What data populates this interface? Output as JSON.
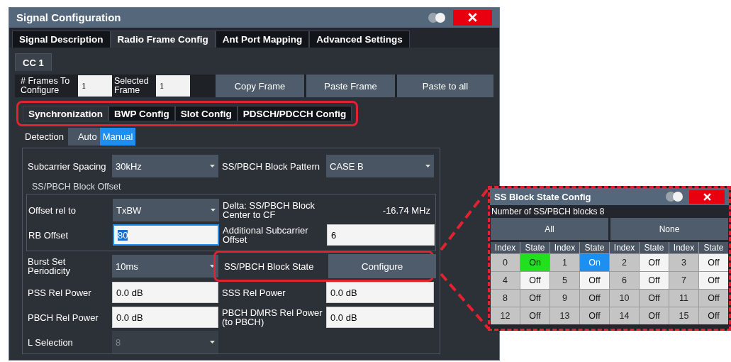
{
  "dialog": {
    "title": "Signal Configuration"
  },
  "tabs": [
    {
      "label": "Signal Description",
      "selected": false
    },
    {
      "label": "Radio Frame Config",
      "selected": true
    },
    {
      "label": "Ant Port Mapping",
      "selected": false
    },
    {
      "label": "Advanced Settings",
      "selected": false
    }
  ],
  "carrier_tabs": [
    {
      "label": "CC 1",
      "selected": true
    }
  ],
  "frames": {
    "frames_label": "# Frames To Configure",
    "frames_value": "1",
    "selected_label": "Selected Frame",
    "selected_value": "1"
  },
  "frame_buttons": [
    "Copy Frame",
    "Paste Frame",
    "Paste to all"
  ],
  "sub_tabs": {
    "highlighted": true,
    "items": [
      {
        "label": "Synchronization",
        "selected": true
      },
      {
        "label": "BWP Config",
        "selected": false
      },
      {
        "label": "Slot Config",
        "selected": false
      },
      {
        "label": "PDSCH/PDCCH Config",
        "selected": false
      }
    ]
  },
  "detection": {
    "label": "Detection",
    "options": [
      {
        "label": "Auto",
        "selected": false
      },
      {
        "label": "Manual",
        "selected": true
      }
    ]
  },
  "rows_top": [
    {
      "cells": [
        {
          "label": "Subcarrier Spacing",
          "kind": "dropdown",
          "value": "30kHz"
        },
        {
          "label": "SS/PBCH Block Pattern",
          "kind": "dropdown",
          "value": "CASE B"
        }
      ]
    }
  ],
  "offset_group": {
    "label": "SS/PBCH Block Offset",
    "rows": [
      {
        "cells": [
          {
            "label": "Offset rel to",
            "kind": "dropdown",
            "value": "TxBW"
          },
          {
            "label": "Delta: SS/PBCH Block Center to CF",
            "kind": "text",
            "value": "-16.74 MHz"
          }
        ]
      },
      {
        "cells": [
          {
            "label": "RB Offset",
            "kind": "input",
            "value": "80",
            "focused": true
          },
          {
            "label": "Additional Subcarrier Offset",
            "kind": "input",
            "value": "6",
            "focused": false
          }
        ]
      }
    ]
  },
  "rows_bottom": [
    {
      "cells": [
        {
          "label": "Burst Set Periodicity",
          "kind": "dropdown",
          "value": "10ms"
        },
        {
          "label": "SS/PBCH Block State",
          "kind": "button",
          "value": "Configure",
          "highlighted": true
        }
      ]
    },
    {
      "cells": [
        {
          "label": "PSS Rel Power",
          "kind": "input",
          "value": "0.0 dB",
          "focused": false
        },
        {
          "label": "SSS Rel Power",
          "kind": "input",
          "value": "0.0 dB",
          "focused": false
        }
      ]
    },
    {
      "cells": [
        {
          "label": "PBCH Rel Power",
          "kind": "input",
          "value": "0.0 dB",
          "focused": false
        },
        {
          "label": "PBCH DMRS Rel Power (to PBCH)",
          "kind": "input",
          "value": "0.0 dB",
          "focused": false
        }
      ]
    },
    {
      "cells": [
        {
          "label": "L Selection",
          "kind": "dropdown",
          "value": "8",
          "disabled": true
        }
      ]
    }
  ],
  "block_state_popup": {
    "title": "SS Block State Config",
    "count_label": "Number of SS/PBCH blocks 8",
    "buttons": [
      "All",
      "None"
    ],
    "headers": [
      "Index",
      "State",
      "Index",
      "State",
      "Index",
      "State",
      "Index",
      "State"
    ],
    "blocks": [
      {
        "index": "0",
        "state": "On",
        "kind": "focused"
      },
      {
        "index": "1",
        "state": "On",
        "kind": "on"
      },
      {
        "index": "2",
        "state": "Off",
        "kind": "off"
      },
      {
        "index": "3",
        "state": "Off",
        "kind": "off"
      },
      {
        "index": "4",
        "state": "Off",
        "kind": "off"
      },
      {
        "index": "5",
        "state": "Off",
        "kind": "off"
      },
      {
        "index": "6",
        "state": "Off",
        "kind": "off"
      },
      {
        "index": "7",
        "state": "Off",
        "kind": "off"
      },
      {
        "index": "8",
        "state": "Off",
        "kind": "unavailable"
      },
      {
        "index": "9",
        "state": "Off",
        "kind": "unavailable"
      },
      {
        "index": "10",
        "state": "Off",
        "kind": "unavailable"
      },
      {
        "index": "11",
        "state": "Off",
        "kind": "unavailable"
      },
      {
        "index": "12",
        "state": "Off",
        "kind": "unavailable"
      },
      {
        "index": "13",
        "state": "Off",
        "kind": "unavailable"
      },
      {
        "index": "14",
        "state": "Off",
        "kind": "unavailable"
      },
      {
        "index": "15",
        "state": "Off",
        "kind": "unavailable"
      }
    ]
  }
}
